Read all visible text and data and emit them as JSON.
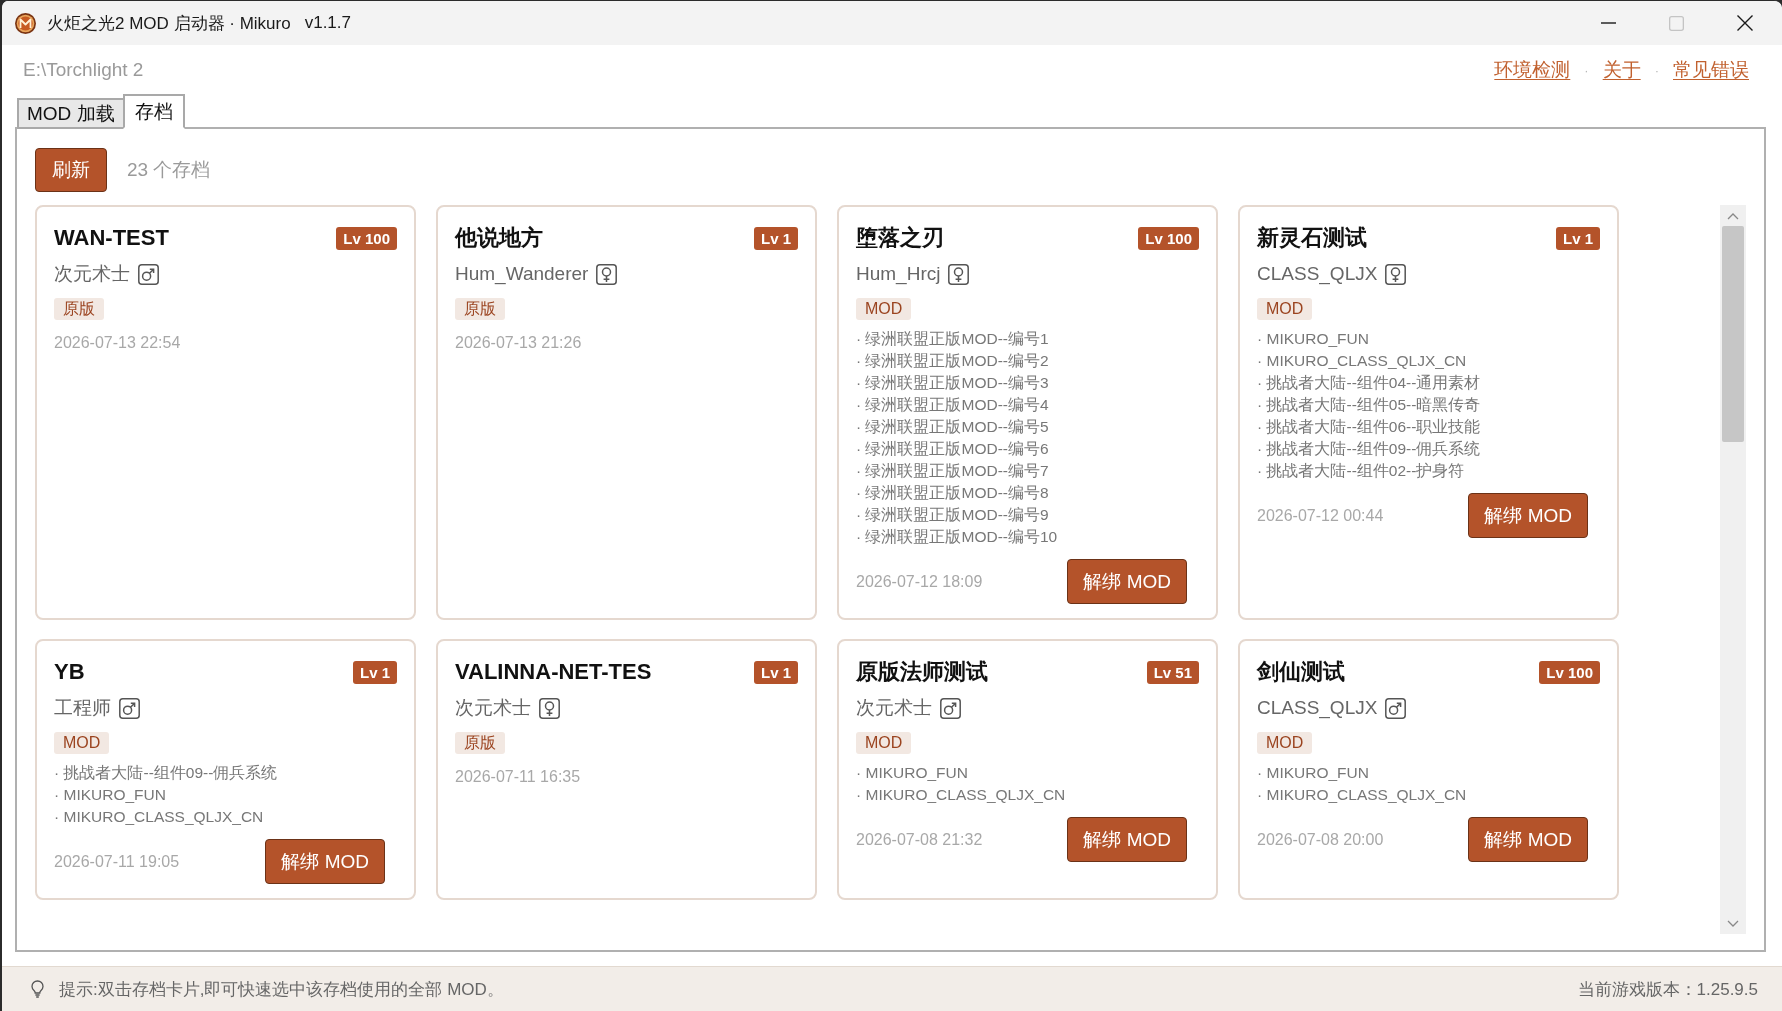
{
  "window": {
    "title": "火炬之光2 MOD 启动器 · Mikuro",
    "version": "v1.1.7",
    "controls": [
      {
        "kind": "minimize",
        "disabled": false
      },
      {
        "kind": "maximize",
        "disabled": true
      },
      {
        "kind": "close",
        "disabled": false
      }
    ]
  },
  "header": {
    "game_path": "E:\\Torchlight 2",
    "links": [
      "环境检测",
      "关于",
      "常见错误"
    ],
    "separators": [
      "·",
      "·"
    ]
  },
  "tabs": [
    {
      "label": "MOD 加载",
      "selected": false
    },
    {
      "label": "存档",
      "selected": true
    }
  ],
  "toolbar": {
    "refresh_button": "刷新",
    "save_count": "23 个存档"
  },
  "saves": [
    {
      "name": "WAN-TEST",
      "lv_badge": "Lv 100",
      "class": "次元术士",
      "female": false,
      "tag": "原版",
      "date": "2026-07-13 22:54"
    },
    {
      "name": "他说地方",
      "lv_badge": "Lv 1",
      "class": "Hum_Wanderer",
      "female": true,
      "tag": "原版",
      "date": "2026-07-13 21:26"
    },
    {
      "name": "堕落之刃",
      "lv_badge": "Lv 100",
      "class": "Hum_Hrcj",
      "female": true,
      "tag": "MOD",
      "mods": [
        "· 绿洲联盟正版MOD--编号1",
        "· 绿洲联盟正版MOD--编号2",
        "· 绿洲联盟正版MOD--编号3",
        "· 绿洲联盟正版MOD--编号4",
        "· 绿洲联盟正版MOD--编号5",
        "· 绿洲联盟正版MOD--编号6",
        "· 绿洲联盟正版MOD--编号7",
        "· 绿洲联盟正版MOD--编号8",
        "· 绿洲联盟正版MOD--编号9",
        "· 绿洲联盟正版MOD--编号10"
      ],
      "date": "2026-07-12 18:09",
      "button": "解绑 MOD"
    },
    {
      "name": "新灵石测试",
      "lv_badge": "Lv 1",
      "class": "CLASS_QLJX",
      "female": true,
      "tag": "MOD",
      "mods": [
        "· MIKURO_FUN",
        "· MIKURO_CLASS_QLJX_CN",
        "· 挑战者大陆--组件04--通用素材",
        "· 挑战者大陆--组件05--暗黑传奇",
        "· 挑战者大陆--组件06--职业技能",
        "· 挑战者大陆--组件09--佣兵系统",
        "· 挑战者大陆--组件02--护身符"
      ],
      "date": "2026-07-12 00:44",
      "button": "解绑 MOD"
    },
    {
      "name": "YB",
      "lv_badge": "Lv 1",
      "class": "工程师",
      "female": false,
      "tag": "MOD",
      "mods": [
        "· 挑战者大陆--组件09--佣兵系统",
        "· MIKURO_FUN",
        "· MIKURO_CLASS_QLJX_CN"
      ],
      "date": "2026-07-11 19:05",
      "button": "解绑 MOD"
    },
    {
      "name": "VALINNA-NET-TES",
      "lv_badge": "Lv 1",
      "class": "次元术士",
      "female": true,
      "tag": "原版",
      "date": "2026-07-11 16:35"
    },
    {
      "name": "原版法师测试",
      "lv_badge": "Lv 51",
      "class": "次元术士",
      "female": false,
      "tag": "MOD",
      "mods": [
        "· MIKURO_FUN",
        "· MIKURO_CLASS_QLJX_CN"
      ],
      "date": "2026-07-08 21:32",
      "button": "解绑 MOD"
    },
    {
      "name": "剑仙测试",
      "lv_badge": "Lv 100",
      "class": "CLASS_QLJX",
      "female": false,
      "tag": "MOD",
      "mods": [
        "· MIKURO_FUN",
        "· MIKURO_CLASS_QLJX_CN"
      ],
      "date": "2026-07-08 20:00",
      "button": "解绑 MOD"
    }
  ],
  "status_bar": {
    "hint": "提示:双击存档卡片,即可快速选中该存档使用的全部 MOD。",
    "game_version": "当前游戏版本：1.25.9.5"
  }
}
